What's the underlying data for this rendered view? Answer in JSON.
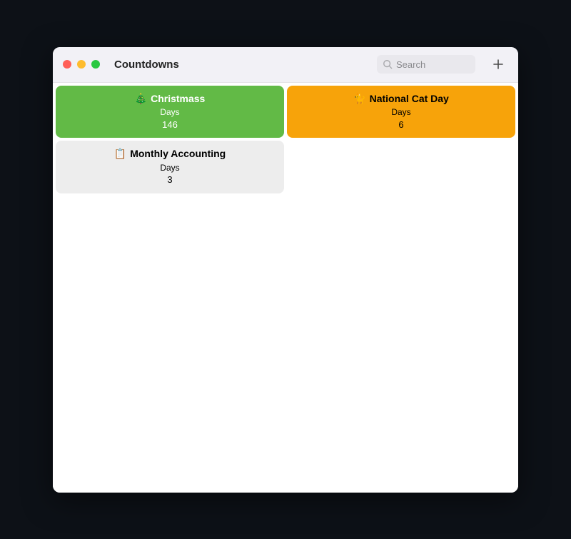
{
  "window": {
    "title": "Countdowns"
  },
  "toolbar": {
    "search_placeholder": "Search"
  },
  "countdowns": [
    {
      "emoji": "🎄",
      "title": "Christmass",
      "days_label": "Days",
      "days_value": "146",
      "color_class": "card-green"
    },
    {
      "emoji": "🐈",
      "title": "National Cat Day",
      "days_label": "Days",
      "days_value": "6",
      "color_class": "card-orange"
    },
    {
      "emoji": "📋",
      "title": "Monthly Accounting",
      "days_label": "Days",
      "days_value": "3",
      "color_class": "card-gray"
    }
  ]
}
